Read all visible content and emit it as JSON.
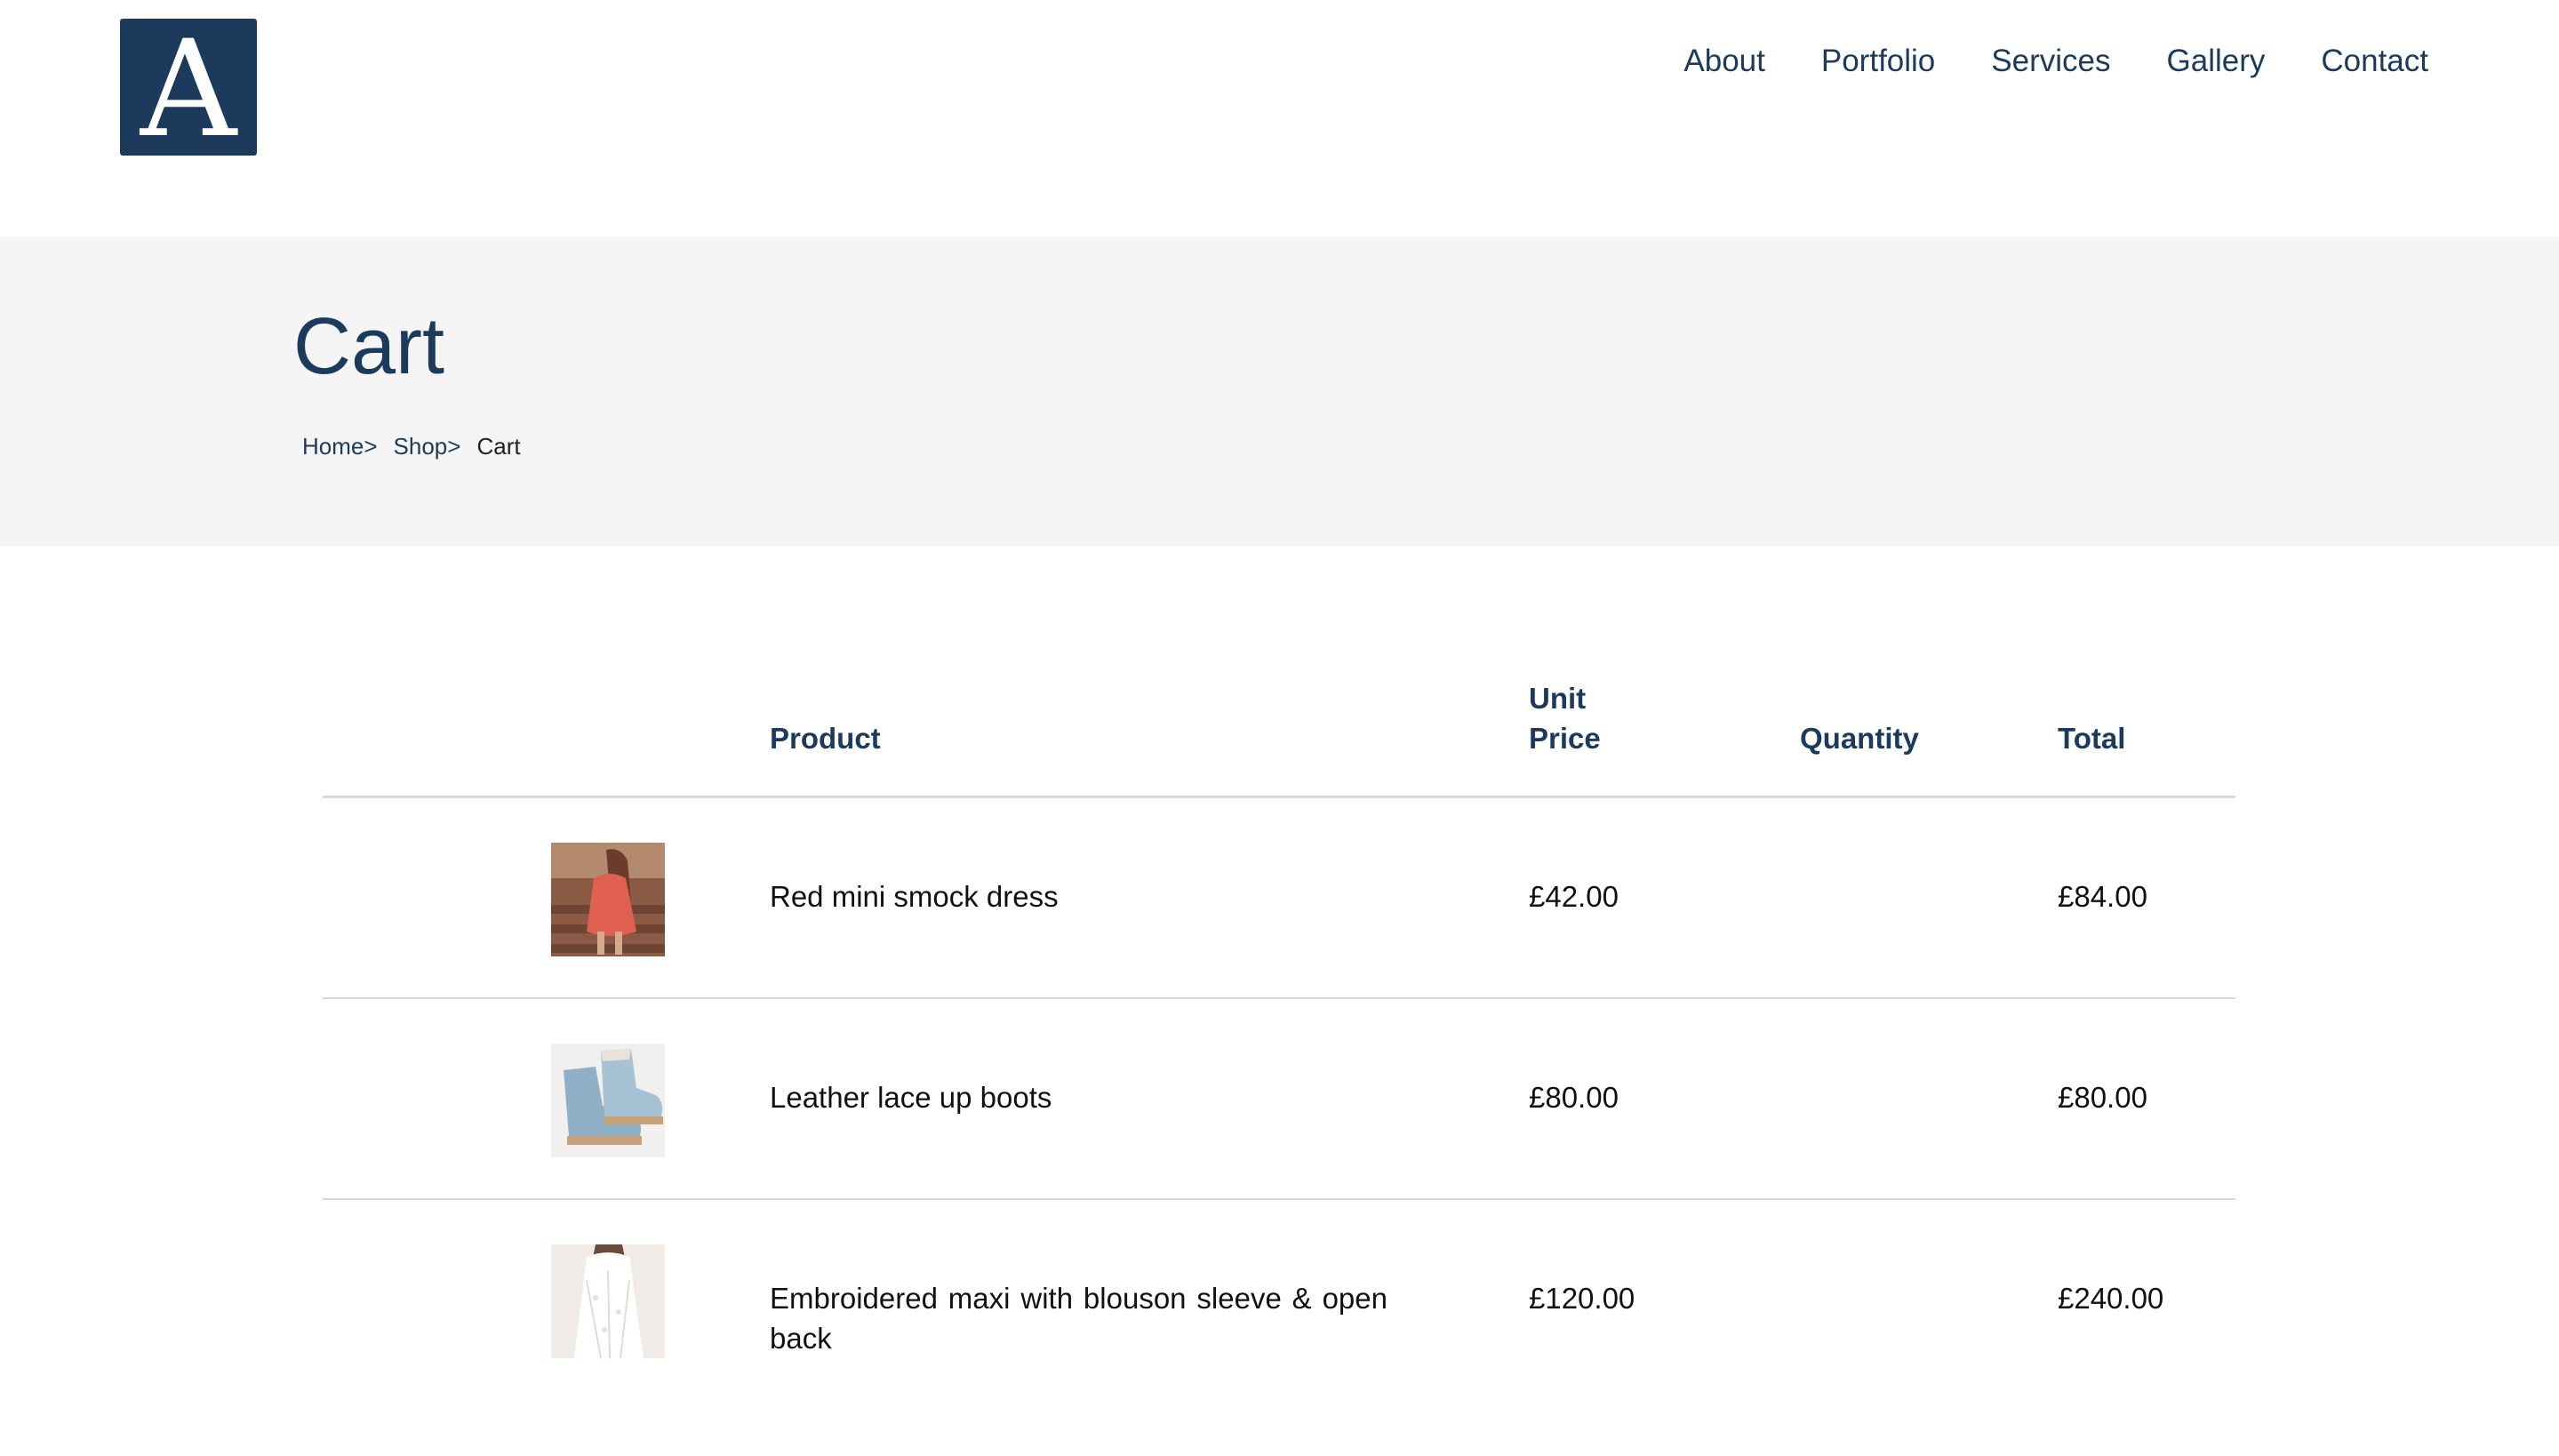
{
  "logo": {
    "letter": "A",
    "color": "#1b3a5c"
  },
  "nav": {
    "items": [
      {
        "label": "About"
      },
      {
        "label": "Portfolio"
      },
      {
        "label": "Services"
      },
      {
        "label": "Gallery"
      },
      {
        "label": "Contact"
      }
    ]
  },
  "banner": {
    "title": "Cart",
    "breadcrumb": [
      {
        "label": "Home>"
      },
      {
        "label": "Shop>"
      },
      {
        "label": "Cart"
      }
    ]
  },
  "cart": {
    "columns": {
      "product": "Product",
      "unit_price": "Unit Price",
      "quantity": "Quantity",
      "total": "Total"
    },
    "rows": [
      {
        "name": "Red mini smock dress",
        "unit_price": "£42.00",
        "total": "£84.00",
        "thumbnail": "red-dress-photo"
      },
      {
        "name": "Leather lace up boots",
        "unit_price": "£80.00",
        "total": "£80.00",
        "thumbnail": "blue-boots-photo"
      },
      {
        "name": "Embroidered maxi with blouson sleeve & open back",
        "unit_price": "£120.00",
        "total": "£240.00",
        "thumbnail": "white-dress-photo"
      }
    ]
  },
  "colors": {
    "brand": "#1b3a5c",
    "banner_bg": "#f5f5f5",
    "divider": "#d9d9d9"
  }
}
